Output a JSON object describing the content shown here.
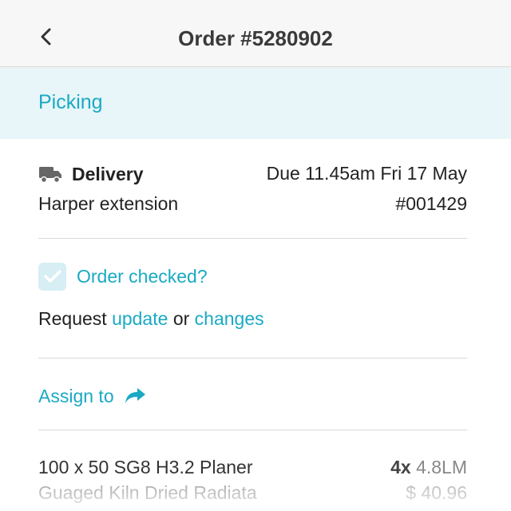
{
  "header": {
    "back_icon": "chevron-left-icon",
    "title": "Order #5280902"
  },
  "status": {
    "label": "Picking",
    "accent_color": "#1aa9c4",
    "band_color": "#e8f6f9"
  },
  "order": {
    "delivery_icon": "truck-icon",
    "delivery_label": "Delivery",
    "due": "Due 11.45am Fri 17 May",
    "job_name": "Harper extension",
    "job_ref": "#001429"
  },
  "checks": {
    "checked_label": "Order checked?",
    "checked": true,
    "request_prefix": "Request",
    "update_link": "update",
    "request_or": "or",
    "changes_link": "changes"
  },
  "assign": {
    "label": "Assign to",
    "icon": "share-arrow-icon"
  },
  "items": [
    {
      "name": "100 x 50 SG8 H3.2 Planer",
      "description": "Guaged Kiln Dried Radiata",
      "qty": "4x",
      "unit": "4.8LM",
      "price": "$ 40.96"
    }
  ]
}
